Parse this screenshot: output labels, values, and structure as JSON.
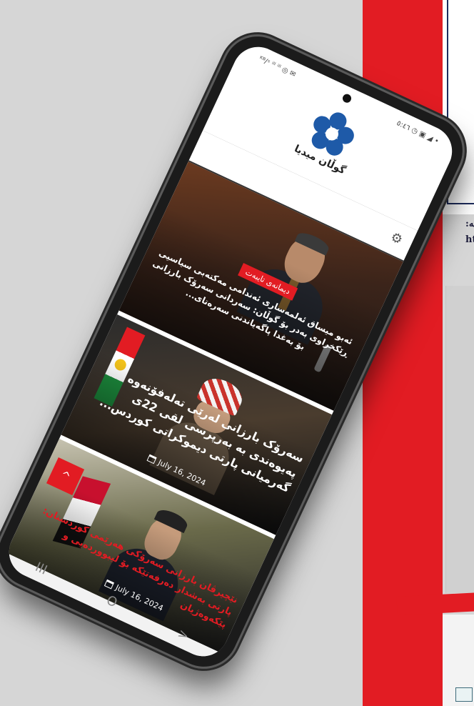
{
  "app": {
    "logo_text": "گوڵان میدیا"
  },
  "statusbar": {
    "left": " ᴷᴮ/ˢ ⁱˡˡ ⁱˡˡ ◎ ✉",
    "right": "٥:٤٦ ◷ ▣ ◢ •"
  },
  "header": {
    "settings_icon": "gear-icon"
  },
  "articles": [
    {
      "badge": "دیمانەی تایبەت",
      "title": "ئەبو میساق ئەلمەساری ئەندامی مەکتەبی سیاسیی ڕێکخراوی بەدر بۆ گوڵان: سەردانی سەرۆک بارزانی بۆ بەغدا پاگەیاندنی سەرەتای...",
      "date": ""
    },
    {
      "badge": "",
      "title": "سەرۆک بارزانی لەرێی تەلەفۆنەوە پەیوەندی بە بەرپرسی لقی 22ی گەرمیانی پارتی دیموکراتی کوردس...",
      "date": "July 16, 2024"
    },
    {
      "badge": "",
      "title": "نێچیرڤان بارزانی سەرۆکی هەرێمی کوردستان: پارتی بەشدار دەرفەتێکە بۆ لیبووردەیی و پێکەوەژیان",
      "date": "July 16, 2024"
    }
  ],
  "controls": {
    "scroll_top": "^"
  },
  "navbar": {
    "recent": "III",
    "home": "O",
    "back": ">"
  },
  "document": {
    "snippet_1": ":ئە",
    "snippet_2": "ht"
  },
  "colors": {
    "accent": "#e21c23",
    "logo": "#1e5aa8"
  }
}
